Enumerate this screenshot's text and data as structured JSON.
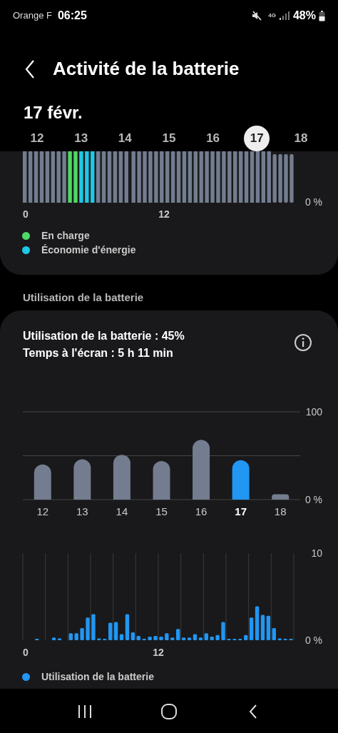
{
  "status_bar": {
    "carrier": "Orange F",
    "time": "06:25",
    "network": "4G",
    "battery": "48%"
  },
  "header": {
    "title": "Activité de la batterie"
  },
  "date": "17 févr.",
  "days": [
    {
      "label": "12",
      "selected": false
    },
    {
      "label": "13",
      "selected": false
    },
    {
      "label": "14",
      "selected": false
    },
    {
      "label": "15",
      "selected": false
    },
    {
      "label": "16",
      "selected": false
    },
    {
      "label": "17",
      "selected": true
    },
    {
      "label": "18",
      "selected": false
    }
  ],
  "history_card": {
    "y_tick": "0 %",
    "x_ticks": [
      "0",
      "12"
    ],
    "legend": [
      {
        "label": "En charge",
        "color": "#4cd964"
      },
      {
        "label": "Économie d'énergie",
        "color": "#1ec8e6"
      }
    ]
  },
  "usage_section": {
    "title": "Utilisation de la batterie"
  },
  "usage_card": {
    "lines": [
      "Utilisation de la batterie : 45%",
      "Temps à l'écran : 5 h 11 min"
    ],
    "daily_chart": {
      "selected": [
        false,
        false,
        false,
        false,
        false,
        true,
        false
      ],
      "chart_data": {
        "type": "bar",
        "categories": [
          "12",
          "13",
          "14",
          "15",
          "16",
          "17",
          "18"
        ],
        "series": [
          {
            "color": "#737d8f",
            "values": [
              40,
              46,
              51,
              44,
              68,
              null,
              6
            ]
          },
          {
            "color": "#2196f3",
            "values": [
              null,
              null,
              null,
              null,
              null,
              45,
              null
            ]
          }
        ],
        "ylim": [
          0,
          100
        ],
        "yticks": [
          {
            "value": 0,
            "label": "0 %"
          },
          {
            "value": 100,
            "label": "100"
          }
        ]
      }
    },
    "hourly_chart": {
      "chart_data": {
        "type": "bar",
        "x": [
          0.25,
          0.75,
          1.25,
          1.75,
          2.25,
          2.75,
          3.25,
          3.75,
          4.25,
          4.75,
          5.25,
          5.75,
          6.25,
          6.75,
          7.25,
          7.75,
          8.25,
          8.75,
          9.25,
          9.75,
          10.25,
          10.75,
          11.25,
          11.75,
          12.25,
          12.75,
          13.25,
          13.75,
          14.25,
          14.75,
          15.25,
          15.75,
          16.25,
          16.75,
          17.25,
          17.75,
          18.25,
          18.75,
          19.25,
          19.75,
          20.25,
          20.75,
          21.25,
          21.75,
          22.25,
          22.75,
          23.25,
          23.75
        ],
        "series": [
          {
            "color": "#2196f3",
            "values": [
              0,
              0,
              0.1,
              0,
              0,
              0.3,
              0.2,
              0,
              0.8,
              0.8,
              1.4,
              2.6,
              3.0,
              0.2,
              0.1,
              2.0,
              2.1,
              0.7,
              3.0,
              0.9,
              0.5,
              0.1,
              0.4,
              0.5,
              0.4,
              0.8,
              0.3,
              1.3,
              0.3,
              0.3,
              0.7,
              0.3,
              0.8,
              0.4,
              0.6,
              2.1,
              0.1,
              0.1,
              0.1,
              0.6,
              2.6,
              3.9,
              2.9,
              2.8,
              1.4,
              0.2,
              0.1,
              0.1
            ]
          }
        ],
        "xlim": [
          0,
          24
        ],
        "xticks": [
          {
            "value": 0,
            "label": "0"
          },
          {
            "value": 12,
            "label": "12"
          }
        ],
        "ylim": [
          0,
          10
        ],
        "yticks": [
          {
            "value": 0,
            "label": "0 %"
          },
          {
            "value": 10,
            "label": "10"
          }
        ]
      }
    },
    "legend": [
      {
        "label": "Utilisation de la batterie",
        "color": "#2196f3"
      }
    ]
  }
}
